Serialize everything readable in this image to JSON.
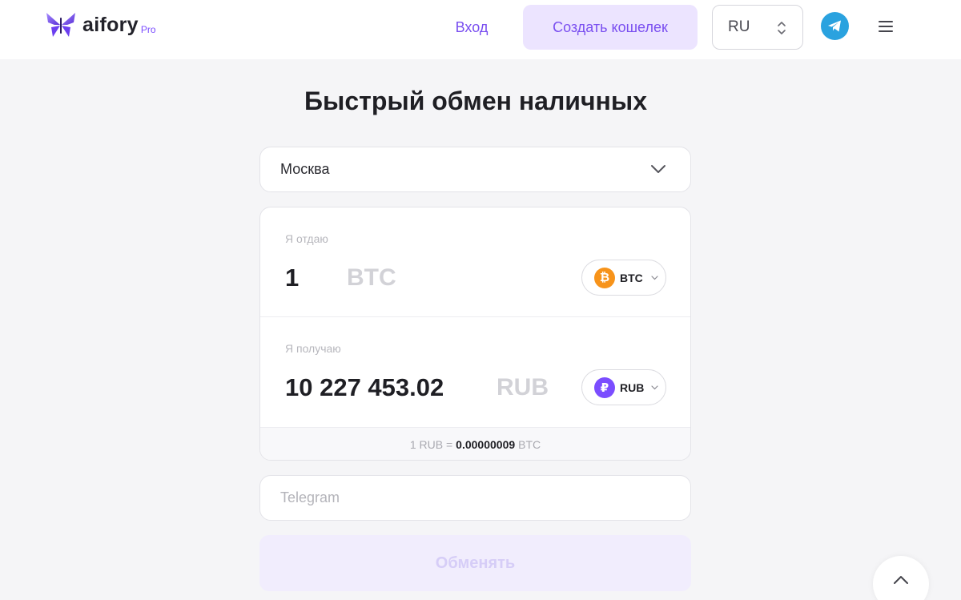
{
  "header": {
    "logo_text": "aifory",
    "logo_badge": "Pro",
    "login_label": "Вход",
    "create_wallet_label": "Создать кошелек",
    "language": "RU",
    "icons": {
      "telegram": "telegram-icon",
      "menu": "hamburger-menu-icon"
    }
  },
  "main": {
    "title": "Быстрый обмен наличных",
    "city": "Москва",
    "give": {
      "label": "Я отдаю",
      "amount": "1",
      "currency_hint": "BTC",
      "currency": "BTC"
    },
    "get": {
      "label": "Я получаю",
      "amount": "10 227 453.02",
      "currency_hint": "RUB",
      "currency": "RUB"
    },
    "rate": {
      "prefix": "1 RUB =",
      "value": "0.00000009",
      "suffix": "BTC"
    },
    "telegram_placeholder": "Telegram",
    "submit_label": "Обменять"
  },
  "colors": {
    "accent": "#7a4ff0",
    "accent_light": "#ece4ff",
    "btc": "#f7931a",
    "rub": "#7b4dff",
    "telegram": "#2aa2df"
  }
}
